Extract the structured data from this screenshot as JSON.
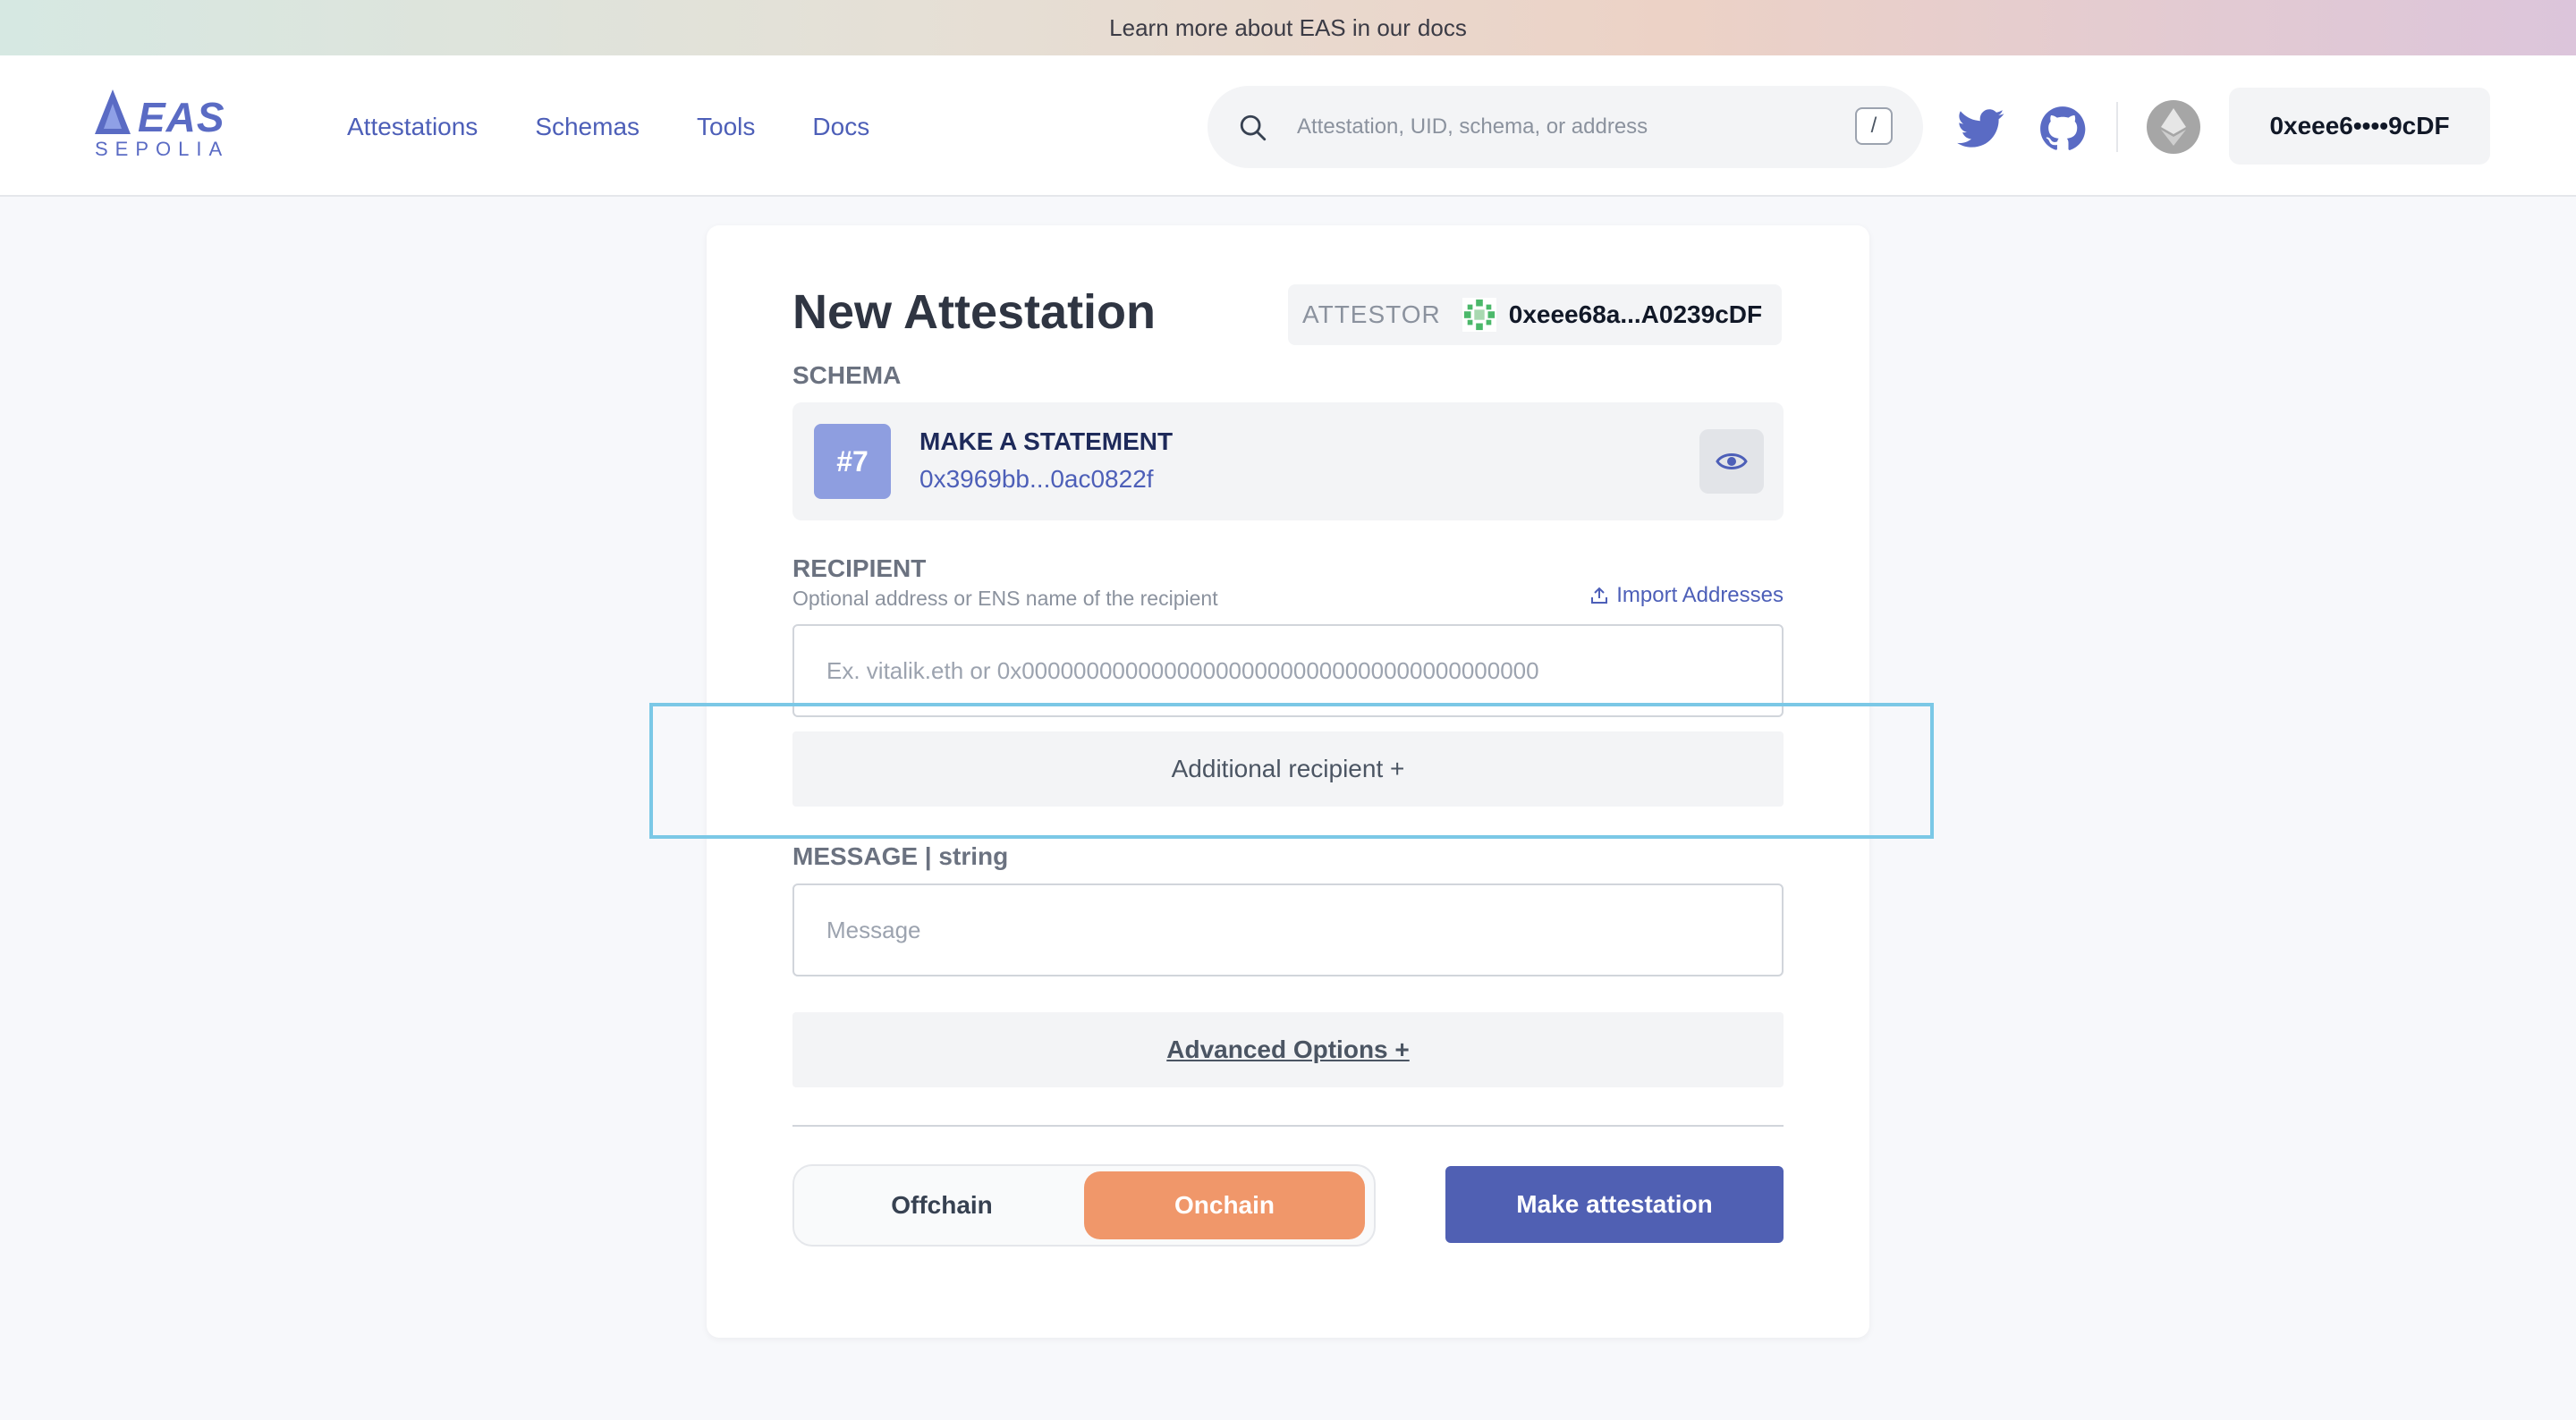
{
  "banner": {
    "prefix": "Learn more about EAS in our",
    "link": "docs"
  },
  "logo": {
    "brand": "EAS",
    "network": "SEPOLIA"
  },
  "nav": [
    {
      "label": "Attestations"
    },
    {
      "label": "Schemas"
    },
    {
      "label": "Tools"
    },
    {
      "label": "Docs"
    }
  ],
  "search": {
    "placeholder": "Attestation, UID, schema, or address",
    "shortcut": "/"
  },
  "wallet": {
    "address": "0xeee6••••9cDF"
  },
  "form": {
    "title": "New Attestation",
    "attestor_label": "ATTESTOR",
    "attestor_address": "0xeee68a...A0239cDF",
    "schema_label": "SCHEMA",
    "schema": {
      "number": "#7",
      "name": "MAKE A STATEMENT",
      "uid": "0x3969bb...0ac0822f"
    },
    "recipient_label": "RECIPIENT",
    "recipient_help": "Optional address or ENS name of the recipient",
    "import_label": "Import Addresses",
    "recipient_placeholder": "Ex. vitalik.eth or 0x0000000000000000000000000000000000000000",
    "additional_recipient": "Additional recipient +",
    "message_label": "MESSAGE | string",
    "message_placeholder": "Message",
    "advanced_options": "Advanced Options +",
    "toggle": {
      "offchain": "Offchain",
      "onchain": "Onchain",
      "selected": "Onchain"
    },
    "submit": "Make attestation"
  },
  "colors": {
    "accent": "#4d5fb8",
    "onchain": "#f0976a",
    "primary_button": "#5060b3",
    "highlight": "#7bc8e6"
  }
}
